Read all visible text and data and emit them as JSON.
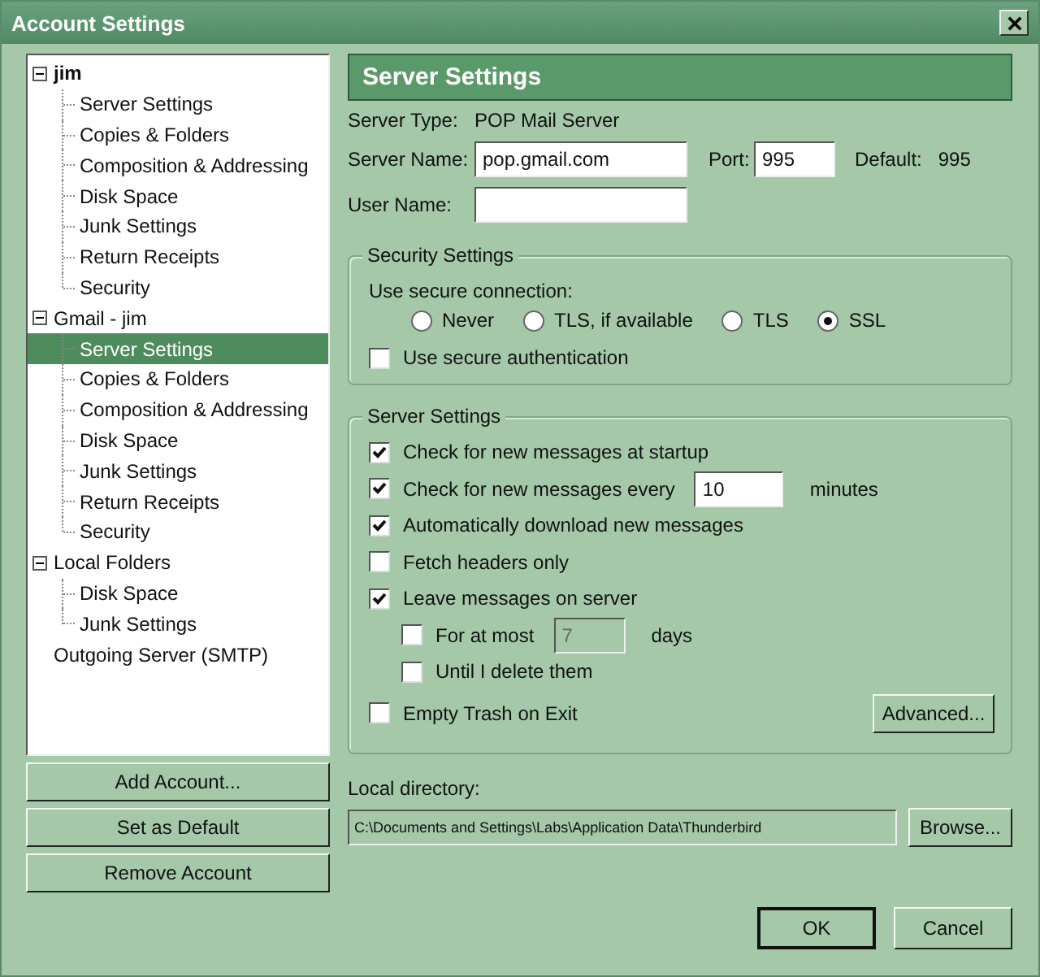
{
  "window": {
    "title": "Account Settings"
  },
  "tree": [
    {
      "label": "jim",
      "is_default": true,
      "expanded": true,
      "selected": false,
      "children": [
        {
          "label": "Server Settings",
          "selected": false
        },
        {
          "label": "Copies & Folders",
          "selected": false
        },
        {
          "label": "Composition & Addressing",
          "selected": false
        },
        {
          "label": "Disk Space",
          "selected": false
        },
        {
          "label": "Junk Settings",
          "selected": false
        },
        {
          "label": "Return Receipts",
          "selected": false
        },
        {
          "label": "Security",
          "selected": false
        }
      ]
    },
    {
      "label": "Gmail - jim",
      "is_default": false,
      "expanded": true,
      "selected": false,
      "children": [
        {
          "label": "Server Settings",
          "selected": true
        },
        {
          "label": "Copies & Folders",
          "selected": false
        },
        {
          "label": "Composition & Addressing",
          "selected": false
        },
        {
          "label": "Disk Space",
          "selected": false
        },
        {
          "label": "Junk Settings",
          "selected": false
        },
        {
          "label": "Return Receipts",
          "selected": false
        },
        {
          "label": "Security",
          "selected": false
        }
      ]
    },
    {
      "label": "Local Folders",
      "is_default": false,
      "expanded": true,
      "selected": false,
      "children": [
        {
          "label": "Disk Space",
          "selected": false
        },
        {
          "label": "Junk Settings",
          "selected": false
        }
      ]
    },
    {
      "label": "Outgoing Server (SMTP)",
      "is_default": false,
      "selected": false
    }
  ],
  "account_buttons": [
    "Add Account...",
    "Set as Default",
    "Remove Account"
  ],
  "panel_title": "Server Settings",
  "server_type": {
    "label": "Server Type:",
    "value": "POP Mail Server"
  },
  "server_name": {
    "label": "Server Name:",
    "value": "pop.gmail.com"
  },
  "port": {
    "label": "Port:",
    "value": "995",
    "default_label": "Default:",
    "default_value": "995"
  },
  "user_name": {
    "label": "User Name:"
  },
  "security": {
    "title": "Security Settings",
    "prompt": "Use secure connection:",
    "radios": [
      {
        "label": "Never",
        "selected": false
      },
      {
        "label": "TLS, if available",
        "selected": false
      },
      {
        "label": "TLS",
        "selected": false
      },
      {
        "label": "SSL",
        "selected": true
      }
    ],
    "auth": {
      "label": "Use secure authentication",
      "checked": false
    }
  },
  "server_settings": {
    "title": "Server Settings",
    "options": [
      {
        "kind": "check",
        "label": "Check for new messages at startup",
        "checked": true
      },
      {
        "kind": "check_field",
        "label": "Check for new messages every",
        "checked": true,
        "field": {
          "value": "10",
          "disabled": false
        },
        "suffix": "minutes"
      },
      {
        "kind": "check",
        "label": "Automatically download new messages",
        "checked": true
      },
      {
        "kind": "check",
        "label": "Fetch headers only",
        "checked": false
      },
      {
        "kind": "check",
        "label": "Leave messages on server",
        "checked": true,
        "children": [
          {
            "kind": "check_field",
            "label": "For at most",
            "checked": false,
            "field": {
              "value": "7",
              "disabled": true
            },
            "suffix": "days"
          },
          {
            "kind": "check",
            "label": "Until I delete them",
            "checked": false
          }
        ]
      },
      {
        "kind": "check",
        "label": "Empty Trash on Exit",
        "checked": false
      }
    ],
    "advanced_button": "Advanced..."
  },
  "local_directory": {
    "label": "Local directory:",
    "value": "C:\\Documents and Settings\\Labs\\Application Data\\Thunderbird",
    "button": "Browse..."
  },
  "dialog_buttons": [
    "OK",
    "Cancel"
  ]
}
